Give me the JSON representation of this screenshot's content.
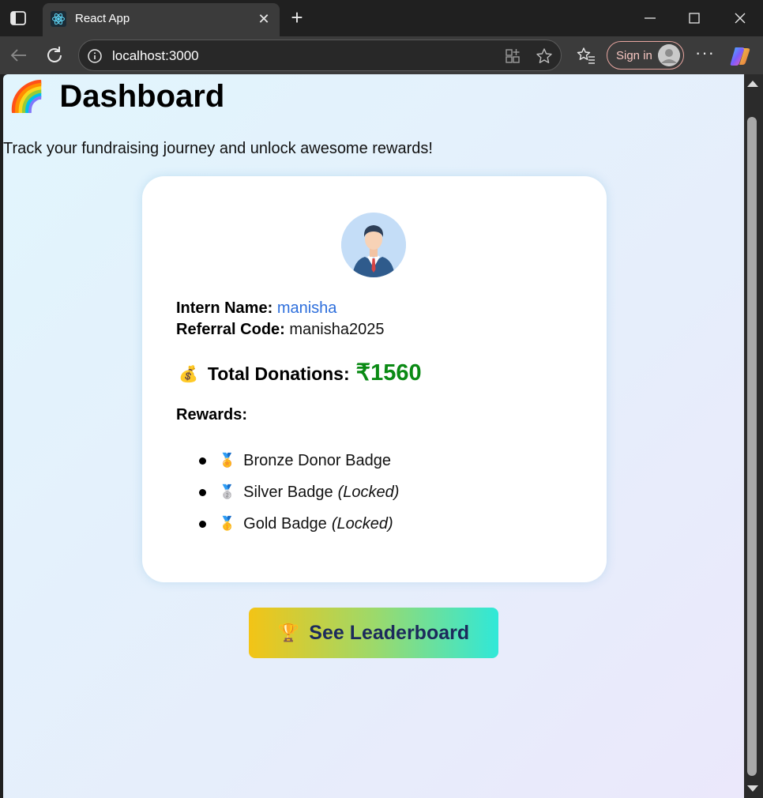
{
  "browser": {
    "tab_title": "React App",
    "url": "localhost:3000",
    "signin_label": "Sign in",
    "tab_close_glyph": "✕",
    "new_tab_glyph": "+",
    "more_glyph": "···"
  },
  "page": {
    "title_emoji": "🌈",
    "title": "Dashboard",
    "subtitle": "Track your fundraising journey and unlock awesome rewards!"
  },
  "card": {
    "intern_name_label": "Intern Name:",
    "intern_name": "manisha",
    "referral_label": "Referral Code:",
    "referral_code": "manisha2025",
    "donations_emoji": "💰",
    "donations_label": "Total Donations:",
    "donations_amount": "₹1560",
    "rewards_label": "Rewards:",
    "rewards": [
      {
        "medal": "🏅",
        "name": "Bronze Donor Badge",
        "status": ""
      },
      {
        "medal": "🥈",
        "name": "Silver Badge",
        "status": "(Locked)"
      },
      {
        "medal": "🥇",
        "name": "Gold Badge",
        "status": "(Locked)"
      }
    ]
  },
  "leaderboard_button": {
    "emoji": "🏆",
    "label": "See Leaderboard"
  },
  "colors": {
    "name_link": "#2e6fdc",
    "donation_amount": "#0a8a14",
    "button_gradient": [
      "#f3c416",
      "#9dd96a",
      "#30e8d8"
    ]
  }
}
